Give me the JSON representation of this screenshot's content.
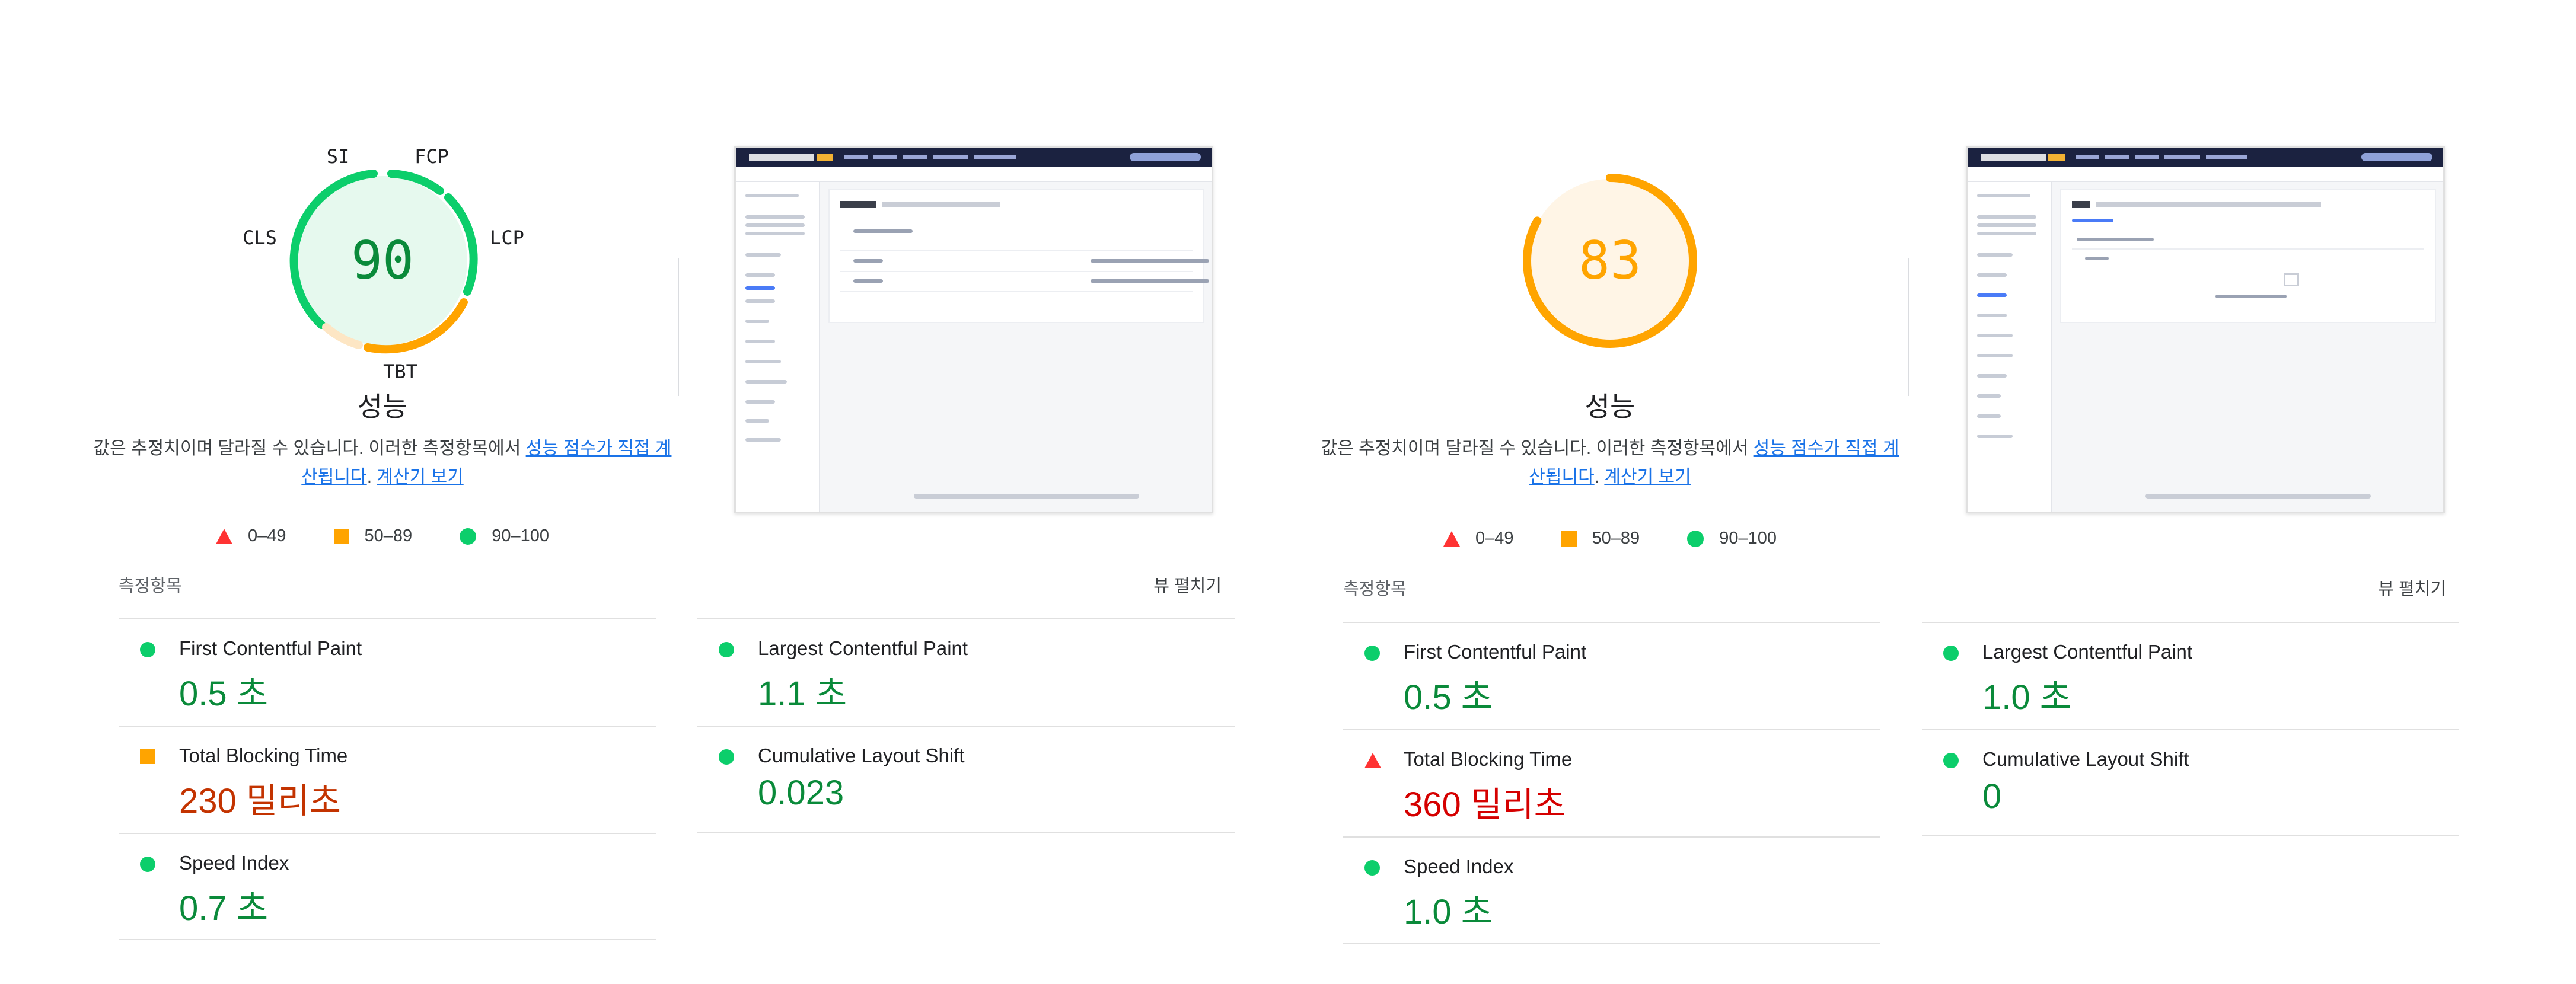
{
  "panels": [
    {
      "score": 90,
      "score_color": "#0cce6b",
      "score_text_color": "#0a8a3a",
      "score_fill": "#e6f9ee",
      "title": "성능",
      "desc_prefix": "값은 추정치이며 달라질 수 있습니다. 이러한 측정항목에서 ",
      "desc_link1": "성능 점수가 직접 계산됩니다",
      "desc_dot": ". ",
      "desc_link2": "계산기 보기",
      "gauge_labels": {
        "si": "SI",
        "fcp": "FCP",
        "lcp": "LCP",
        "cls": "CLS",
        "tbt": "TBT"
      },
      "legend": {
        "poor": "0–49",
        "avg": "50–89",
        "good": "90–100"
      },
      "metrics_label": "측정항목",
      "expand_label": "뷰 펼치기",
      "metrics": {
        "fcp": {
          "name": "First Contentful Paint",
          "value": "0.5 초",
          "rating": "good"
        },
        "tbt": {
          "name": "Total Blocking Time",
          "value": "230 밀리초",
          "rating": "avg"
        },
        "si": {
          "name": "Speed Index",
          "value": "0.7 초",
          "rating": "good"
        },
        "lcp": {
          "name": "Largest Contentful Paint",
          "value": "1.1 초",
          "rating": "good"
        },
        "cls": {
          "name": "Cumulative Layout Shift",
          "value": "0.023",
          "rating": "good"
        }
      }
    },
    {
      "score": 83,
      "score_color": "#ffa400",
      "score_text_color": "#ffa400",
      "score_fill": "#fff5e6",
      "title": "성능",
      "desc_prefix": "값은 추정치이며 달라질 수 있습니다. 이러한 측정항목에서 ",
      "desc_link1": "성능 점수가 직접 계산됩니다",
      "desc_dot": ". ",
      "desc_link2": "계산기 보기",
      "legend": {
        "poor": "0–49",
        "avg": "50–89",
        "good": "90–100"
      },
      "metrics_label": "측정항목",
      "expand_label": "뷰 펼치기",
      "metrics": {
        "fcp": {
          "name": "First Contentful Paint",
          "value": "0.5 초",
          "rating": "good"
        },
        "tbt": {
          "name": "Total Blocking Time",
          "value": "360 밀리초",
          "rating": "poor"
        },
        "si": {
          "name": "Speed Index",
          "value": "1.0 초",
          "rating": "good"
        },
        "lcp": {
          "name": "Largest Contentful Paint",
          "value": "1.0 초",
          "rating": "good"
        },
        "cls": {
          "name": "Cumulative Layout Shift",
          "value": "0",
          "rating": "good"
        }
      }
    }
  ]
}
